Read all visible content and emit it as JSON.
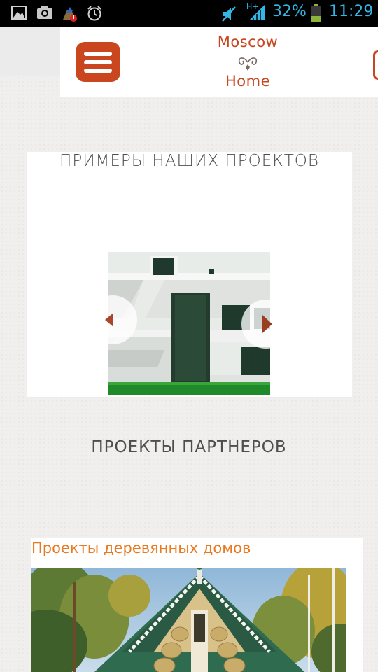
{
  "status_bar": {
    "network_label": "H+",
    "battery_percent": "32%",
    "time": "11:29",
    "icons": [
      "gallery-icon",
      "camera-icon",
      "notification-icon",
      "alarm-icon",
      "mute-icon",
      "signal-icon",
      "battery-icon"
    ]
  },
  "header": {
    "logo_top": "Moscow",
    "logo_bottom": "Home",
    "accent_color": "#c9461e"
  },
  "our_projects": {
    "title": "ПРИМЕРЫ НАШИХ ПРОЕКТОВ"
  },
  "partners": {
    "title": "ПРОЕКТЫ ПАРТНЕРОВ",
    "card_title": "Проекты деревянных домов",
    "card_title_color": "#e8791e"
  }
}
